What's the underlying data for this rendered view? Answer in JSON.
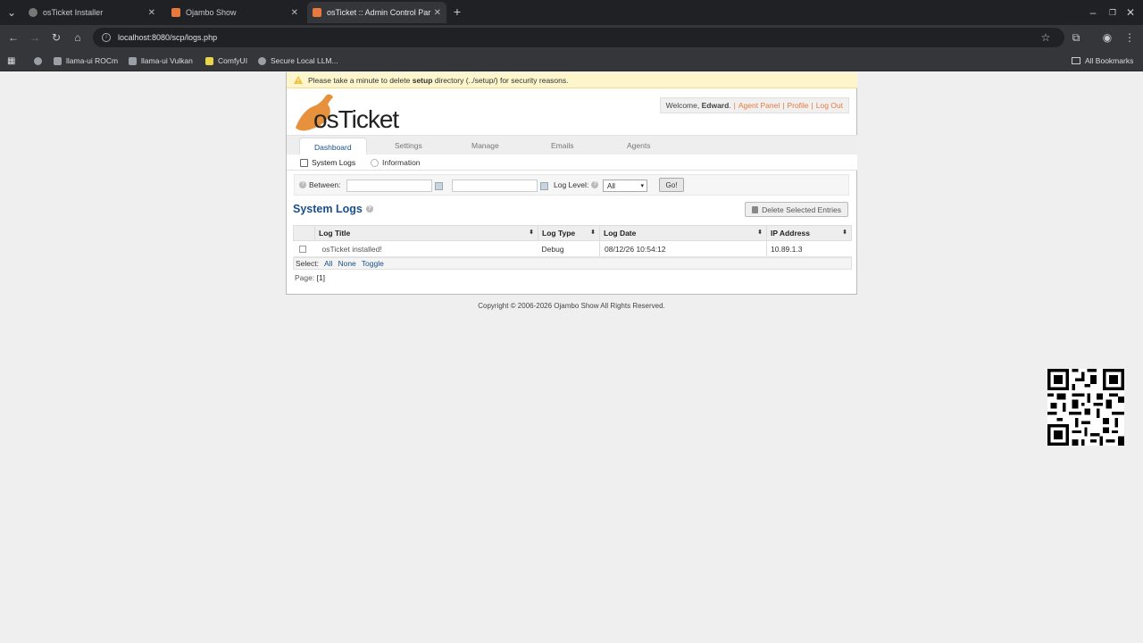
{
  "browser": {
    "tabs": [
      {
        "label": "osTicket Installer"
      },
      {
        "label": "Ojambo Show"
      },
      {
        "label": "osTicket :: Admin Control Par"
      }
    ],
    "url": "localhost:8080/scp/logs.php",
    "bookmarks": [
      {
        "label": "llama-ui ROCm"
      },
      {
        "label": "llama-ui Vulkan"
      },
      {
        "label": "ComfyUI"
      },
      {
        "label": "Secure Local LLM..."
      }
    ],
    "all_bookmarks": "All Bookmarks"
  },
  "warning": {
    "pre": "Please take a minute to delete ",
    "bold": "setup",
    "post": " directory (../setup/) for security reasons."
  },
  "logo_text": "osTicket",
  "welcome": {
    "prefix": "Welcome, ",
    "user": "Edward",
    "suffix": ".",
    "agent_panel": "Agent Panel",
    "profile": "Profile",
    "logout": "Log Out"
  },
  "nav": {
    "dashboard": "Dashboard",
    "settings": "Settings",
    "manage": "Manage",
    "emails": "Emails",
    "agents": "Agents"
  },
  "subnav": {
    "system_logs": "System Logs",
    "information": "Information"
  },
  "filter": {
    "between": "Between:",
    "log_level": "Log Level:",
    "level_value": "All",
    "go": "Go!"
  },
  "page_title": "System Logs",
  "delete_button": "Delete Selected Entries",
  "table": {
    "headers": [
      "Log Title",
      "Log Type",
      "Log Date",
      "IP Address"
    ],
    "rows": [
      {
        "title": "osTicket installed!",
        "type": "Debug",
        "date": "08/12/26 10:54:12",
        "ip": "10.89.1.3"
      }
    ]
  },
  "select": {
    "label": "Select:",
    "all": "All",
    "none": "None",
    "toggle": "Toggle"
  },
  "pager": {
    "label": "Page:",
    "current": "[1]"
  },
  "footer": "Copyright © 2006-2026 Ojambo Show All Rights Reserved."
}
